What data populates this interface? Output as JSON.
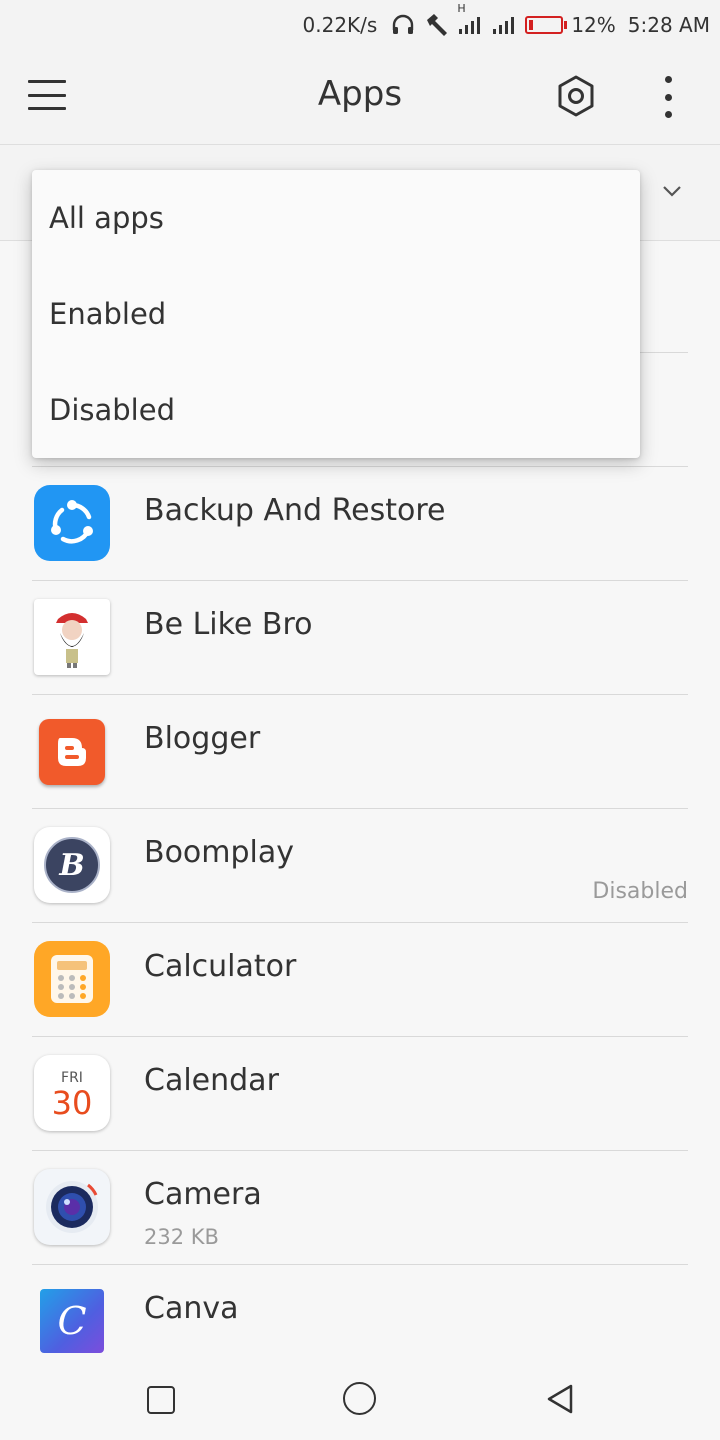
{
  "status_bar": {
    "net_speed": "0.22K/s",
    "network_type": "H",
    "battery_percent": "12%",
    "time": "5:28 AM",
    "icons": [
      "headphones-icon",
      "hammer-icon",
      "signal-icon",
      "signal-icon",
      "battery-icon"
    ],
    "battery_color": "#d32020"
  },
  "toolbar": {
    "title": "Apps",
    "icons": [
      "menu-icon",
      "settings-icon",
      "more-vert-icon"
    ]
  },
  "filter": {
    "options": [
      "All apps",
      "Enabled",
      "Disabled"
    ],
    "expand_icon": "chevron-down-icon"
  },
  "apps": [
    {
      "name": "Backup And Restore",
      "icon": "backup-restore-icon",
      "color": "#2196f3"
    },
    {
      "name": "Be Like Bro",
      "icon": "be-like-bro-icon"
    },
    {
      "name": "Blogger",
      "icon": "blogger-icon",
      "color": "#f15a2b"
    },
    {
      "name": "Boomplay",
      "icon": "boomplay-icon",
      "state": "Disabled"
    },
    {
      "name": "Calculator",
      "icon": "calculator-icon",
      "color": "#ffa726"
    },
    {
      "name": "Calendar",
      "icon": "calendar-icon",
      "calendar_day": "FRI",
      "calendar_date": "30"
    },
    {
      "name": "Camera",
      "icon": "camera-icon",
      "size": "232 KB"
    },
    {
      "name": "Canva",
      "icon": "canva-icon",
      "icon_letter": "C"
    }
  ],
  "nav_bar": {
    "icons": [
      "recent-apps-icon",
      "home-icon",
      "back-icon"
    ]
  }
}
